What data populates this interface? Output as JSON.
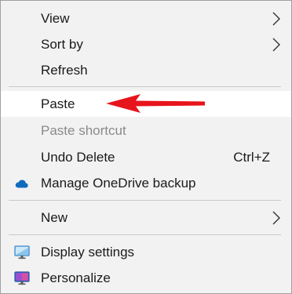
{
  "menu": {
    "items": {
      "view": {
        "label": "View",
        "icon": "chevron-right-icon"
      },
      "sort_by": {
        "label": "Sort by",
        "icon": "chevron-right-icon"
      },
      "refresh": {
        "label": "Refresh"
      },
      "paste": {
        "label": "Paste",
        "state": "highlighted"
      },
      "paste_shortcut": {
        "label": "Paste shortcut",
        "state": "disabled"
      },
      "undo_delete": {
        "label": "Undo Delete",
        "shortcut": "Ctrl+Z"
      },
      "onedrive": {
        "label": "Manage OneDrive backup",
        "icon": "onedrive-cloud-icon"
      },
      "new": {
        "label": "New",
        "icon": "chevron-right-icon"
      },
      "display_settings": {
        "label": "Display settings",
        "icon": "monitor-icon"
      },
      "personalize": {
        "label": "Personalize",
        "icon": "personalize-icon"
      }
    }
  },
  "annotation": {
    "type": "arrow",
    "color": "#e8141c",
    "points_to": "paste"
  },
  "colors": {
    "menu_background": "#f2f2f2",
    "highlight_background": "#ffffff",
    "disabled_text": "#8a8a8a",
    "separator": "#c8c8c8",
    "onedrive_blue": "#0f6cbd"
  }
}
